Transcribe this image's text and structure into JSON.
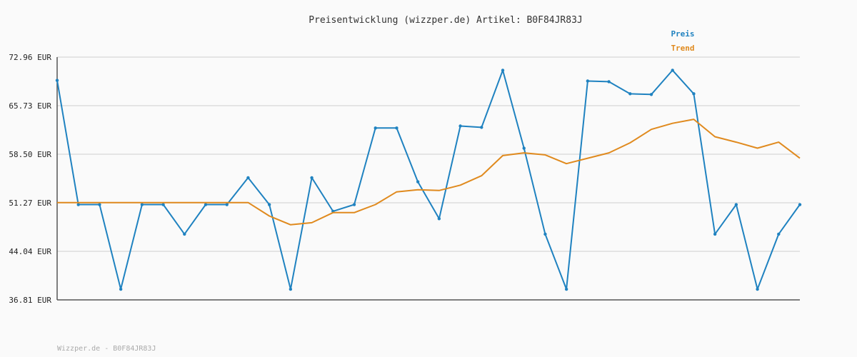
{
  "chart_data": {
    "type": "line",
    "title": "Preisentwicklung (wizzper.de) Artikel: B0F84JR83J",
    "xlabel": "",
    "ylabel": "",
    "ylim": [
      36.81,
      72.96
    ],
    "y_ticks": [
      "72.96 EUR",
      "65.73 EUR",
      "58.50 EUR",
      "51.27 EUR",
      "44.04 EUR",
      "36.81 EUR"
    ],
    "y_tick_values": [
      72.96,
      65.73,
      58.5,
      51.27,
      44.04,
      36.81
    ],
    "grid": true,
    "legend_position": "top-right",
    "series": [
      {
        "name": "Preis",
        "color": "#1f82c0",
        "values": [
          69.5,
          51.0,
          51.0,
          38.4,
          51.0,
          51.0,
          46.6,
          51.0,
          51.0,
          55.0,
          51.0,
          38.4,
          55.0,
          50.0,
          51.0,
          62.4,
          62.4,
          54.4,
          48.9,
          62.7,
          62.5,
          71.0,
          59.4,
          46.6,
          38.4,
          69.4,
          69.3,
          67.5,
          67.4,
          71.0,
          67.5,
          46.6,
          51.0,
          38.4,
          46.6,
          51.0
        ]
      },
      {
        "name": "Trend",
        "color": "#e08a1e",
        "values": [
          51.3,
          51.3,
          51.3,
          51.3,
          51.3,
          51.3,
          51.3,
          51.3,
          51.3,
          51.3,
          49.3,
          48.0,
          48.3,
          49.8,
          49.8,
          51.0,
          52.9,
          53.2,
          53.1,
          53.9,
          55.3,
          58.3,
          58.7,
          58.4,
          57.1,
          57.9,
          58.7,
          60.2,
          62.2,
          63.1,
          63.7,
          61.1,
          60.3,
          59.4,
          60.3,
          57.9
        ]
      }
    ]
  },
  "footer": "Wizzper.de - B0F84JR83J"
}
